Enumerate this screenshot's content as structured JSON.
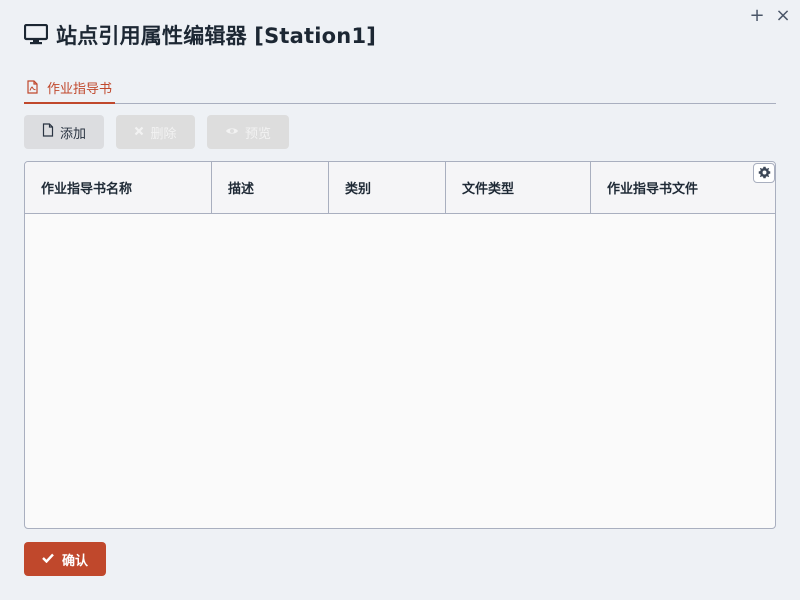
{
  "window": {
    "title": "站点引用属性编辑器 [Station1]",
    "title_icon": "monitor-icon",
    "controls": {
      "maximize": "+",
      "close": "×"
    }
  },
  "tabs": [
    {
      "label": "作业指导书",
      "icon": "pdf-file-icon",
      "active": true
    }
  ],
  "toolbar": {
    "add_label": "添加",
    "delete_label": "删除",
    "preview_label": "预览"
  },
  "grid": {
    "columns": [
      "作业指导书名称",
      "描述",
      "类别",
      "文件类型",
      "作业指导书文件"
    ],
    "rows": []
  },
  "footer": {
    "confirm_label": "确认"
  },
  "colors": {
    "accent": "#c0482c",
    "background": "#eef1f5",
    "border": "#a9afbf"
  }
}
